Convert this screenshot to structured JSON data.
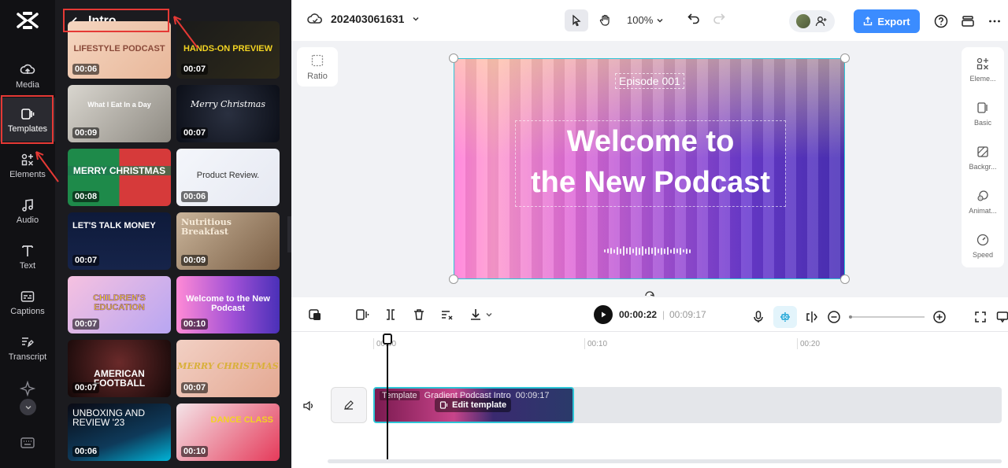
{
  "nav": {
    "items": [
      {
        "label": "Media",
        "icon": "cloud-upload-icon"
      },
      {
        "label": "Templates",
        "icon": "template-icon"
      },
      {
        "label": "Elements",
        "icon": "elements-icon"
      },
      {
        "label": "Audio",
        "icon": "music-note-icon"
      },
      {
        "label": "Text",
        "icon": "text-icon"
      },
      {
        "label": "Captions",
        "icon": "captions-icon"
      },
      {
        "label": "Transcript",
        "icon": "transcript-icon"
      }
    ]
  },
  "panel": {
    "title": "Intro",
    "cards": [
      {
        "title": "LIFESTYLE PODCAST",
        "duration": "00:06"
      },
      {
        "title": "HANDS-ON PREVIEW",
        "duration": "00:07"
      },
      {
        "title": "What I Eat In a Day",
        "duration": "00:09"
      },
      {
        "title": "Merry Christmas",
        "duration": "00:07"
      },
      {
        "title": "MERRY CHRISTMAS",
        "duration": "00:08"
      },
      {
        "title": "Product Review.",
        "duration": "00:06"
      },
      {
        "title": "LET'S TALK MONEY",
        "duration": "00:07"
      },
      {
        "title": "Nutritious Breakfast",
        "duration": "00:09"
      },
      {
        "title": "CHILDREN'S EDUCATION",
        "duration": "00:07"
      },
      {
        "title": "Welcome to the New Podcast",
        "duration": "00:10"
      },
      {
        "title": "AMERICAN FOOTBALL",
        "duration": "00:07"
      },
      {
        "title": "MERRY CHRISTMAS",
        "duration": "00:07"
      },
      {
        "title": "UNBOXING AND REVIEW '23",
        "duration": "00:06"
      },
      {
        "title": "DANCE CLASS",
        "duration": "00:10"
      }
    ]
  },
  "topbar": {
    "project_name": "202403061631",
    "zoom": "100%",
    "export_label": "Export"
  },
  "canvas": {
    "ratio_label": "Ratio",
    "episode": "Episode 001",
    "headline_line1": "Welcome to",
    "headline_line2": "the New Podcast"
  },
  "right_panel": {
    "items": [
      {
        "label": "Eleme...",
        "icon": "elements-icon"
      },
      {
        "label": "Basic",
        "icon": "basic-icon"
      },
      {
        "label": "Backgr...",
        "icon": "background-icon"
      },
      {
        "label": "Animat...",
        "icon": "animation-icon"
      },
      {
        "label": "Speed",
        "icon": "speed-icon"
      }
    ]
  },
  "timeline": {
    "current_time": "00:00:22",
    "separator": "|",
    "total_time": "00:09:17",
    "ruler": [
      "00:00",
      "00:10",
      "00:20"
    ],
    "clip": {
      "tag": "Template",
      "name": "Gradient Podcast Intro",
      "duration": "00:09:17",
      "edit_label": "Edit template"
    }
  },
  "colors": {
    "accent": "#3b8cff",
    "selection": "#2ec5d6",
    "annotation": "#e53935",
    "sidebar_bg": "#111114",
    "panel_bg": "#1b1b1f"
  }
}
